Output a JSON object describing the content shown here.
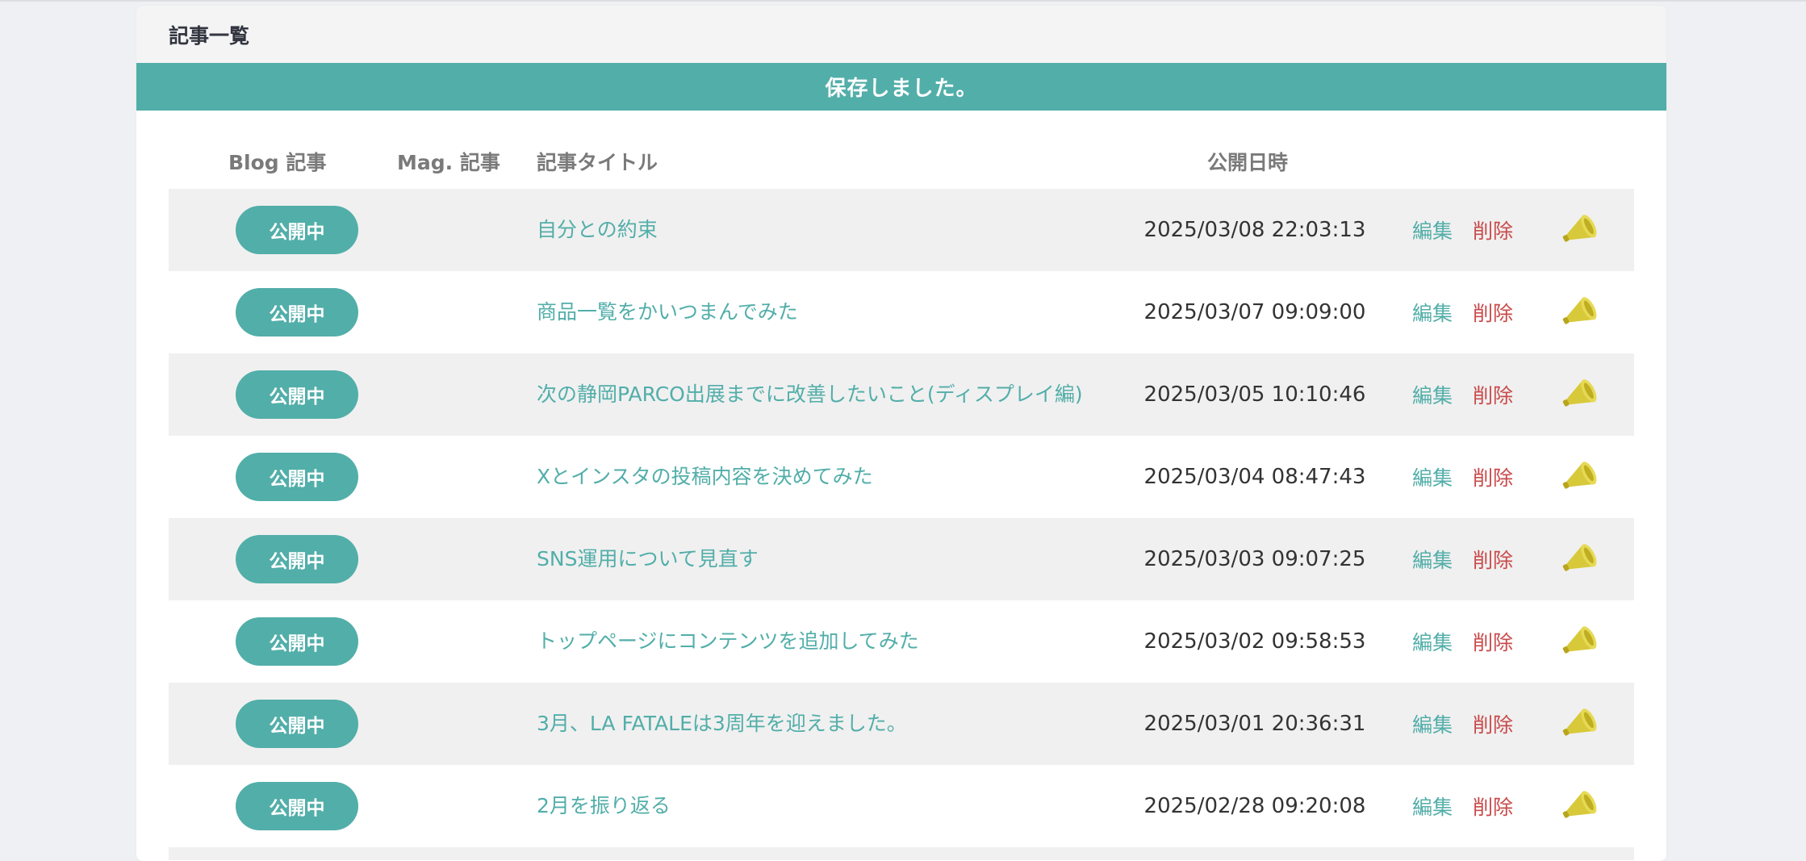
{
  "card": {
    "title": "記事一覧",
    "flash_message": "保存しました。"
  },
  "table": {
    "headers": {
      "blog": "Blog 記事",
      "mag": "Mag. 記事",
      "title": "記事タイトル",
      "published_at": "公開日時"
    },
    "rows": [
      {
        "status": "公開中",
        "title": "自分との約束",
        "date": "2025/03/08 22:03:13",
        "edit": "編集",
        "delete": "削除"
      },
      {
        "status": "公開中",
        "title": "商品一覧をかいつまんでみた",
        "date": "2025/03/07 09:09:00",
        "edit": "編集",
        "delete": "削除"
      },
      {
        "status": "公開中",
        "title": "次の静岡PARCO出展までに改善したいこと(ディスプレイ編)",
        "date": "2025/03/05 10:10:46",
        "edit": "編集",
        "delete": "削除"
      },
      {
        "status": "公開中",
        "title": "Xとインスタの投稿内容を決めてみた",
        "date": "2025/03/04 08:47:43",
        "edit": "編集",
        "delete": "削除"
      },
      {
        "status": "公開中",
        "title": "SNS運用について見直す",
        "date": "2025/03/03 09:07:25",
        "edit": "編集",
        "delete": "削除"
      },
      {
        "status": "公開中",
        "title": "トップページにコンテンツを追加してみた",
        "date": "2025/03/02 09:58:53",
        "edit": "編集",
        "delete": "削除"
      },
      {
        "status": "公開中",
        "title": "3月、LA FATALEは3周年を迎えました。",
        "date": "2025/03/01 20:36:31",
        "edit": "編集",
        "delete": "削除"
      },
      {
        "status": "公開中",
        "title": "2月を振り返る",
        "date": "2025/02/28 09:20:08",
        "edit": "編集",
        "delete": "削除"
      }
    ]
  },
  "colors": {
    "accent": "#52aea9",
    "delete": "#c94a4a",
    "megaphone": "#d8c93a"
  },
  "icons": {
    "promote": "megaphone-icon"
  }
}
